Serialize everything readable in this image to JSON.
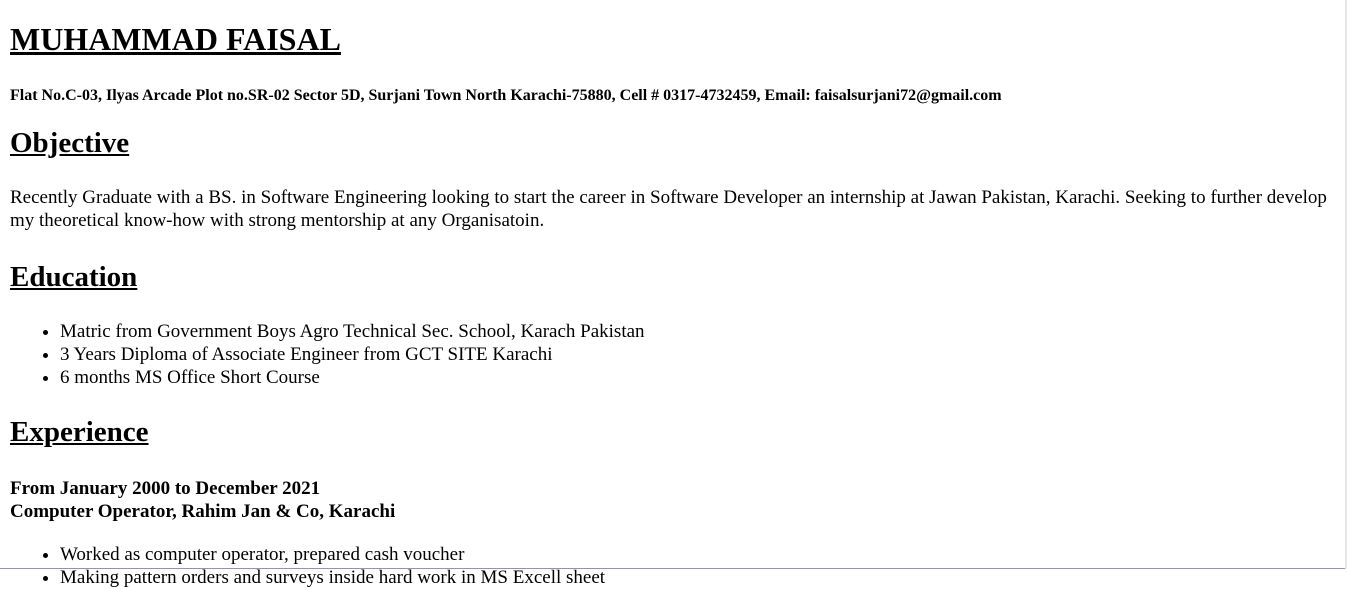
{
  "resume": {
    "name": "MUHAMMAD FAISAL",
    "contact": "Flat No.C-03, Ilyas Arcade Plot no.SR-02 Sector 5D, Surjani Town North Karachi-75880, Cell # 0317-4732459, Email: faisalsurjani72@gmail.com",
    "objective": {
      "heading": "Objective",
      "text": "Recently Graduate with a BS. in Software Engineering looking to start the career in Software Developer an internship at Jawan Pakistan, Karachi. Seeking to further develop my theoretical know-how with strong mentorship at any Organisatoin."
    },
    "education": {
      "heading": "Education",
      "items": [
        "Matric from Government Boys Agro Technical Sec. School, Karach Pakistan",
        "3 Years Diploma of Associate Engineer from GCT SITE Karachi",
        "6 months MS Office Short Course"
      ]
    },
    "experience": {
      "heading": "Experience",
      "period": "From January 2000 to December 2021",
      "role": "Computer Operator, Rahim Jan & Co, Karachi",
      "items": [
        "Worked as computer operator, prepared cash voucher",
        "Making pattern orders and surveys inside hard work in MS Excell sheet"
      ]
    }
  }
}
